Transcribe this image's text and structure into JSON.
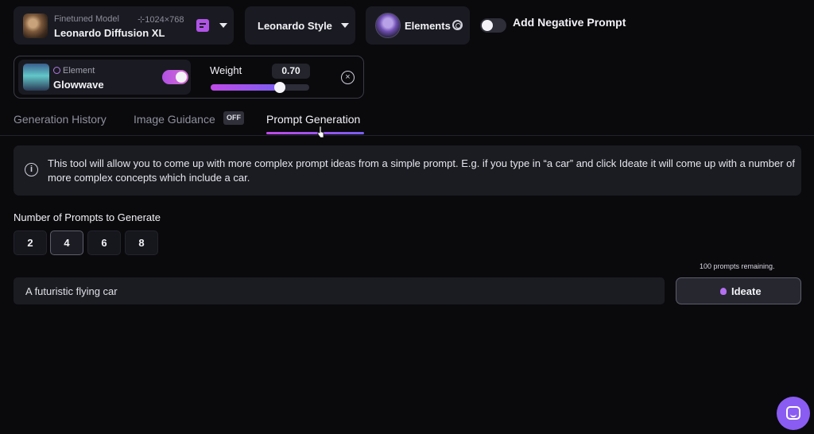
{
  "toolbar": {
    "model": {
      "sub_label": "Finetuned Model",
      "name": "Leonardo Diffusion XL",
      "dimensions": "⊹1024×768"
    },
    "style": {
      "label": "Leonardo Style"
    },
    "elements": {
      "label": "Elements"
    },
    "negative_prompt": {
      "label": "Add Negative Prompt",
      "enabled": false
    }
  },
  "element_panel": {
    "kind": "Element",
    "name": "Glowwave",
    "enabled": true,
    "weight_label": "Weight",
    "weight_value": "0.70",
    "weight": 0.7,
    "close_glyph": "×"
  },
  "tabs": {
    "history": "Generation History",
    "guidance": "Image Guidance",
    "guidance_badge": "OFF",
    "prompt": "Prompt Generation",
    "active": "prompt"
  },
  "info": {
    "icon_glyph": "i",
    "text": "This tool will allow you to come up with more complex prompt ideas from a simple prompt. E.g. if you type in “a car” and click Ideate it will come up with a number of more complex concepts which include a car."
  },
  "prompt_count": {
    "label": "Number of Prompts to Generate",
    "options": [
      "2",
      "4",
      "6",
      "8"
    ],
    "selected": "4"
  },
  "ideate": {
    "remaining": "100 prompts remaining.",
    "input_value": "A futuristic flying car",
    "button_label": "Ideate"
  },
  "colors": {
    "accent_purple": "#b250e6",
    "accent_violet": "#7a5ef2",
    "chat_button": "#8a5cf2"
  },
  "icons": [
    "model-thumbnail",
    "edit-icon",
    "chevron-down-icon",
    "gear-icon",
    "flower-icon",
    "close-icon",
    "info-icon",
    "bulb-icon",
    "chat-icon"
  ]
}
